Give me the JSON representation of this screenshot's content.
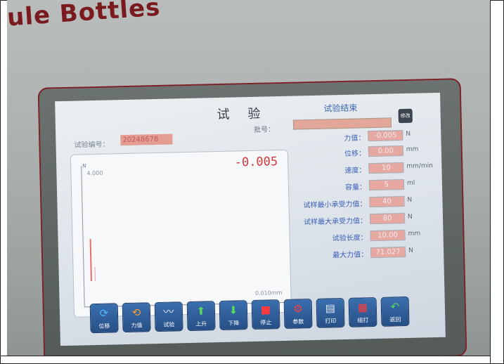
{
  "brand_text": "ule Bottles",
  "screen": {
    "title": "试 验",
    "status": "试验结束",
    "edit_button": "修改",
    "batch_label": "批号：",
    "batch_value": "",
    "test_number_label": "试验编号：",
    "test_number_value": "20248678"
  },
  "graph": {
    "current_value": "-0.005",
    "y_axis_unit": "N",
    "y_max_label": "4.000",
    "x_max_label": "0.010mm"
  },
  "params": [
    {
      "label": "力值：",
      "value": "-0.005",
      "unit": "N"
    },
    {
      "label": "位移：",
      "value": "0.00",
      "unit": "mm"
    },
    {
      "label": "速度：",
      "value": "10",
      "unit": "mm/min"
    },
    {
      "label": "容量：",
      "value": "5",
      "unit": "ml"
    },
    {
      "label": "试样最小承受力值：",
      "value": "40",
      "unit": "N"
    },
    {
      "label": "试样最大承受力值：",
      "value": "80",
      "unit": "N"
    },
    {
      "label": "试验长度：",
      "value": "10.00",
      "unit": "mm"
    },
    {
      "label": "最大力值：",
      "value": "71.027",
      "unit": "N"
    }
  ],
  "buttons": [
    {
      "label": "位移",
      "icon": "refresh-icon"
    },
    {
      "label": "力值",
      "icon": "sync-icon"
    },
    {
      "label": "试验",
      "icon": "chart-icon"
    },
    {
      "label": "上升",
      "icon": "arrow-up-icon"
    },
    {
      "label": "下降",
      "icon": "arrow-down-icon"
    },
    {
      "label": "停止",
      "icon": "stop-icon"
    },
    {
      "label": "参数",
      "icon": "gear-icon"
    },
    {
      "label": "打印",
      "icon": "printer-icon"
    },
    {
      "label": "组打",
      "icon": "group-print-icon"
    },
    {
      "label": "返回",
      "icon": "return-icon"
    }
  ]
}
